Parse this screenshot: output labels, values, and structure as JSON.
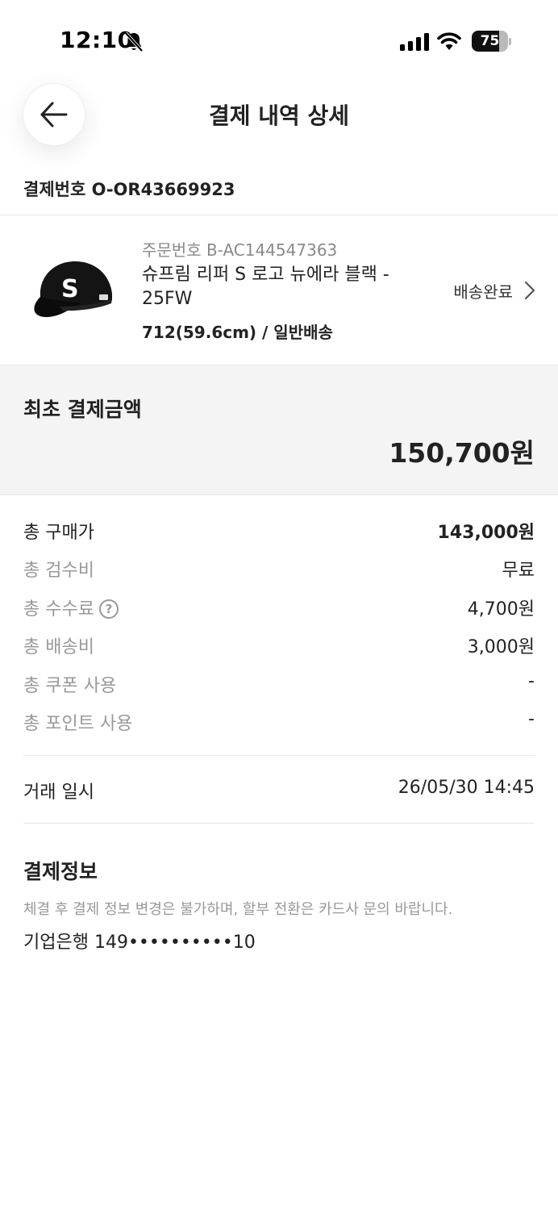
{
  "status_bar": {
    "time": "12:10",
    "battery": "75",
    "battery_level": 0.75,
    "icons": [
      "bell-slash-icon",
      "cellular-signal-icon",
      "wifi-icon",
      "battery-icon"
    ]
  },
  "header": {
    "title": "결제 내역 상세",
    "back_icon": "arrow-left-icon"
  },
  "payment_number": "결제번호 O-OR43669923",
  "product": {
    "order_number": "주문번호 B-AC144547363",
    "name": "슈프림 리퍼 S 로고 뉴에라 블랙 - 25FW",
    "option": "712(59.6cm) / 일반배송",
    "status": "배송완료",
    "status_icon": "chevron-right-icon"
  },
  "initial_payment": {
    "label": "최초 결제금액",
    "amount": "150,700원"
  },
  "breakdown": {
    "purchase_label": "총 구매가",
    "purchase_value": "143,000원",
    "inspection_label": "총 검수비",
    "inspection_value": "무료",
    "fee_label": "총 수수료",
    "fee_help": "?",
    "fee_value": "4,700원",
    "shipping_label": "총 배송비",
    "shipping_value": "3,000원",
    "coupon_label": "총 쿠폰 사용",
    "coupon_value": "-",
    "point_label": "총 포인트 사용",
    "point_value": "-"
  },
  "transaction": {
    "label": "거래 일시",
    "value": "26/05/30 14:45"
  },
  "payment_info": {
    "title": "결제정보",
    "note": "체결 후 결제 정보 변경은 불가하며, 할부 전환은 카드사 문의 바랍니다.",
    "card": "기업은행 149••••••••••10"
  }
}
